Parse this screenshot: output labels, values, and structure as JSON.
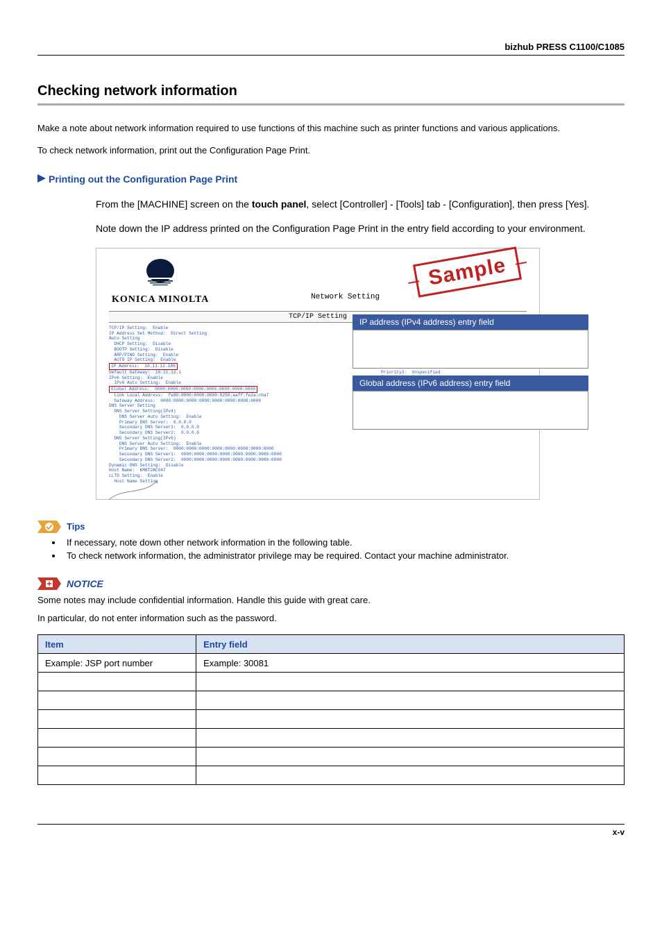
{
  "header": {
    "product": "bizhub PRESS C1100/C1085"
  },
  "section": {
    "title": "Checking network information",
    "intro1": "Make a note about network information required to use functions of this machine such as printer functions and various applications.",
    "intro2": "To check network information, print out the Configuration Page Print."
  },
  "subsection": {
    "title": "Printing out the Configuration Page Print",
    "p1_pre": "From the [MACHINE] screen on the ",
    "p1_bold": "touch panel",
    "p1_post": ", select [Controller] - [Tools] tab - [Configuration], then press [Yes].",
    "p2": "Note down the IP address printed on the Configuration Page Print in the entry field according to your environment."
  },
  "figure": {
    "logo_text": "KONICA MINOLTA",
    "stamp": "Sample",
    "doc_title": "Network Setting",
    "bar": "TCP/IP Setting",
    "callout1": "IP address (IPv4 address) entry field",
    "callout2": "Global address (IPv6 address) entry field",
    "left_pre_ip": "TCP/IP Setting:  Enable\nIP Address Set Method:  Direct Setting\nAuto Setting\n  DHCP Setting:  Disable\n  BOOTP Setting:  Disable\n  ARP/PING Setting:  Enable\n  AUTO IP Setting:  Enable",
    "ip_line": "IP Address:  10.11.12.186",
    "left_mid": "Default Gateway:  10.11.12.1\nIPv6 Setting:  Enable\n  IPv6 Auto Setting:  Enable",
    "global_line": "Global Address:  0000:0000:0000:0000:0000:0000:0000:0000",
    "left_post": "  Link Local Address:  fe80:0000:0000:0000:0250:aaff:fe2a:c0a7\n  Gateway Address:  0000:0000:0000:0000:0000:0000:0000:0000\nDNS Server Setting\n  DNS Server Setting(IPv4)\n    DNS Server Auto Setting:  Enable\n    Primary DNS Server:  0.0.0.0\n    Secondary DNS Server1:  0.0.0.0\n    Secondary DNS Server2:  0.0.0.0\n  DNS Server Setting(IPv6)\n    DNS Server Auto Setting:  Enable\n    Primary DNS Server:  0000:0000:0000:0000:0000:0000:0000:0000\n    Secondary DNS Server1:  0000:0000:0000:0000:0000:0000:0000:0000\n    Secondary DNS Server2:  0000:0000:0000:0000:0000:0000:0000:0000\nDynamic DNS Setting:  Disable\nHost Name:  KMBT2AC047\nLLTD Setting:  Enable\n  Host Name Setting",
    "right_text": "Priority2:  Unspecified\nPriority3:  Unspecified\nPriority4:  Unspecified"
  },
  "tips": {
    "label": "Tips",
    "items": [
      "If necessary, note down other network information in the following table.",
      "To check network information, the administrator privilege may be required. Contact your machine administrator."
    ]
  },
  "notice": {
    "label": "NOTICE",
    "p1": "Some notes may include confidential information. Handle this guide with great care.",
    "p2": "In particular, do not enter information such as the password."
  },
  "table": {
    "h1": "Item",
    "h2": "Entry field",
    "r1c1": "Example: JSP port number",
    "r1c2": "Example: 30081"
  },
  "footer": {
    "page": "x-v"
  }
}
